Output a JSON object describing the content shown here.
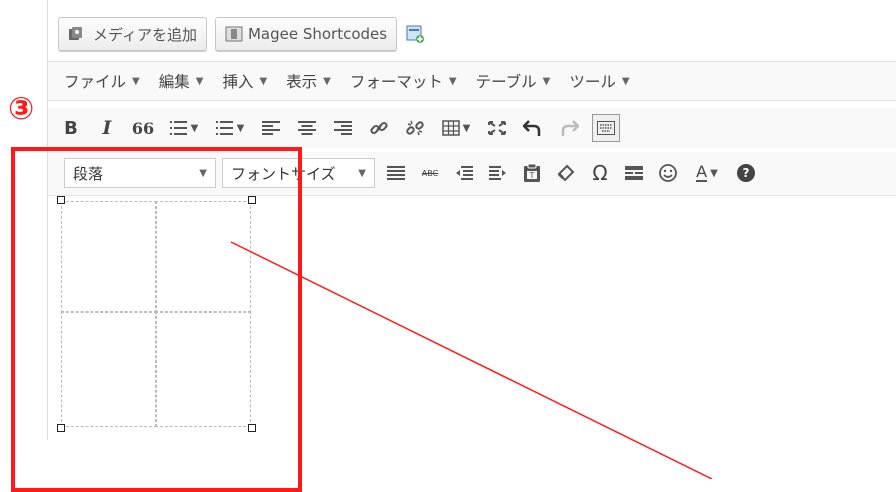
{
  "media_buttons": {
    "add_media": "メディアを追加",
    "shortcodes": "Magee Shortcodes"
  },
  "menubar": [
    {
      "label": "ファイル"
    },
    {
      "label": "編集"
    },
    {
      "label": "挿入"
    },
    {
      "label": "表示"
    },
    {
      "label": "フォーマット"
    },
    {
      "label": "テーブル"
    },
    {
      "label": "ツール"
    }
  ],
  "toolbar1": {
    "bold": "B",
    "italic": "I",
    "quote": "66"
  },
  "toolbar2": {
    "paragraph_select": "段落",
    "fontsize_select": "フォントサイズ",
    "strikethrough": "ABC",
    "omega": "Ω",
    "text_color": "A",
    "help": "?"
  },
  "annotation": {
    "number": "③",
    "color": "#ff1a1a"
  }
}
